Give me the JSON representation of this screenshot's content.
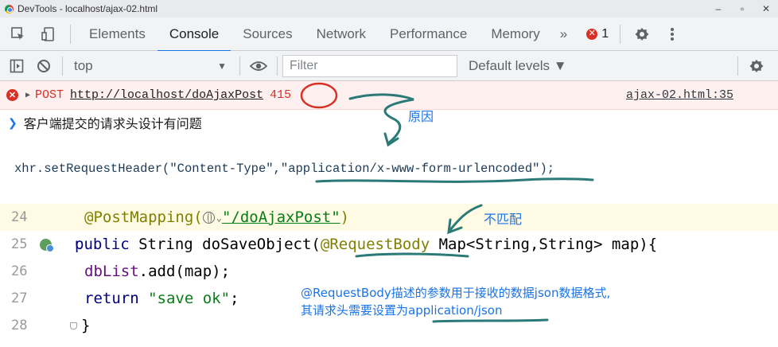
{
  "window": {
    "title": "DevTools - localhost/ajax-02.html",
    "controls": [
      "–",
      "▫",
      "✕"
    ]
  },
  "tabbar": {
    "tabs": [
      "Elements",
      "Console",
      "Sources",
      "Network",
      "Performance",
      "Memory"
    ],
    "active_tab": "Console",
    "more": "»",
    "error_count": "1",
    "error_icon": "✕",
    "icons": [
      "inspect-icon",
      "device-toggle-icon",
      "settings-gear-icon",
      "kebab-menu-icon"
    ]
  },
  "console_toolbar": {
    "context": "top",
    "context_arrow": "▼",
    "filter_placeholder": "Filter",
    "levels": "Default levels ▼",
    "icons": [
      "sidebar-toggle-icon",
      "clear-console-icon",
      "live-expression-eye-icon",
      "console-settings-gear-icon"
    ]
  },
  "error_row": {
    "method": "POST",
    "url": "http://localhost/doAjaxPost",
    "status": "415",
    "source": "ajax-02.html:35"
  },
  "message_row": {
    "text": "客户端提交的请求头设计有问题"
  },
  "snippet": {
    "prefix": "xhr.",
    "method": "setRequestHeader",
    "open": "(",
    "arg1": "\"Content-Type\"",
    "comma": ",",
    "arg2": "\"application/x-www-form-urlencoded\"",
    "close": ");"
  },
  "editor": {
    "lines": [
      {
        "num": "24",
        "annotation": "@PostMapping(",
        "path": "\"/doAjaxPost\"",
        "close": ")"
      },
      {
        "num": "25",
        "kw": "public",
        "type": " String ",
        "method": "doSaveObject(",
        "anno": "@RequestBody",
        "rest": " Map<String,String> map){"
      },
      {
        "num": "26",
        "field": "dbList",
        "rest": ".add(map);"
      },
      {
        "num": "27",
        "kw": "return",
        "str": "\"save ok\"",
        "semi": ";"
      },
      {
        "num": "28",
        "brace": "}"
      }
    ]
  },
  "annotations": {
    "reason": "原因",
    "mismatch": "不匹配",
    "explain_line1": "@RequestBody描述的参数用于接收的数据json数据格式,",
    "explain_line2": "其请求头需要设置为application/json",
    "color": "#1a73e8",
    "circle_color": "#d93025",
    "arrow_color": "#2a7a78"
  }
}
